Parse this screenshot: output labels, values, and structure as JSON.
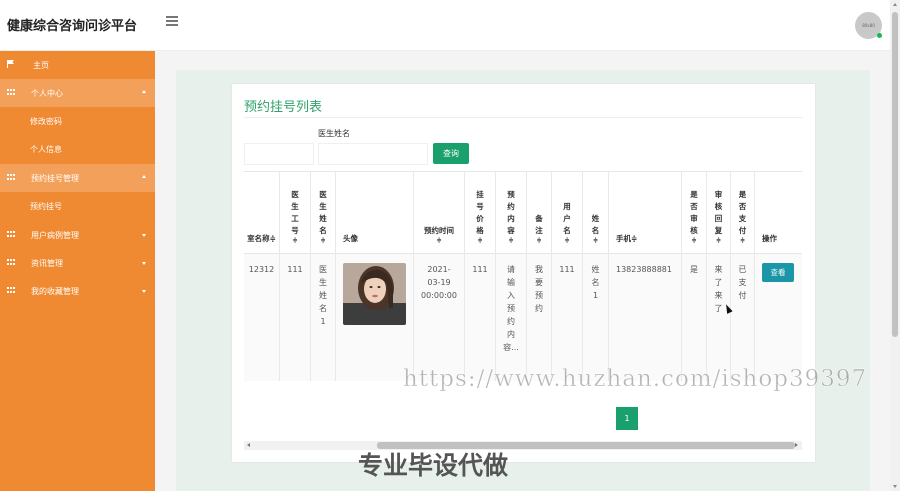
{
  "app": {
    "title": "健康综合咨询问诊平台",
    "avatar_text": "80x80"
  },
  "sidebar": {
    "items": [
      {
        "label": "主页",
        "icon": "flag-icon"
      },
      {
        "label": "个人中心",
        "icon": "grid-icon",
        "expanded": true
      },
      {
        "label": "修改密码",
        "sub": true
      },
      {
        "label": "个人信息",
        "sub": true
      },
      {
        "label": "预约挂号管理",
        "icon": "grid-icon",
        "expanded": true
      },
      {
        "label": "预约挂号",
        "sub": true
      },
      {
        "label": "用户病例管理",
        "icon": "grid-icon",
        "expanded": false
      },
      {
        "label": "资讯管理",
        "icon": "grid-icon",
        "expanded": false
      },
      {
        "label": "我的收藏管理",
        "icon": "grid-icon",
        "expanded": false
      }
    ]
  },
  "main": {
    "title": "预约挂号列表",
    "filter": {
      "doctor_label": "医生姓名",
      "doctor_value": "",
      "left_value": "",
      "search_button": "查询"
    },
    "table": {
      "headers": [
        "科室名称",
        "医生工号",
        "医生姓名",
        "头像",
        "预约时间",
        "挂号价格",
        "预约内容",
        "备注",
        "用户名",
        "姓名",
        "手机",
        "是否审核",
        "审核回复",
        "是否支付",
        "操作"
      ],
      "headers_display": [
        "室名称",
        "医\n生\n工\n号",
        "医\n生\n姓\n名",
        "头像",
        "预约时间",
        "挂\n号\n价\n格",
        "预\n约\n内\n容",
        "备\n注",
        "用\n户\n名",
        "姓\n名",
        "手机",
        "是\n否\n审\n核",
        "审\n核\n回\n复",
        "是\n否\n支\n付",
        "操作"
      ],
      "sortable": [
        true,
        true,
        true,
        false,
        true,
        true,
        true,
        true,
        true,
        true,
        true,
        true,
        true,
        true,
        false
      ],
      "rows": [
        {
          "dept": "12312",
          "doctor_id": "111",
          "doctor_name": "医\n生\n姓\n名\n1",
          "avatar": "avatar-photo",
          "time": "2021-\n03-19\n00:00:00",
          "price": "111",
          "content": "请\n输\n入\n预\n约\n内\n容...",
          "note": "我\n要\n预\n约",
          "username": "111",
          "name": "姓\n名\n1",
          "phone": "13823888881",
          "reviewed": "是",
          "reply": "来\n了\n来\n了",
          "paid": "已\n支\n付",
          "action": "查看"
        }
      ]
    },
    "pagination": {
      "current": "1"
    }
  },
  "watermarks": {
    "url": "https://www.huzhan.com/ishop39397",
    "text": "专业毕设代做"
  },
  "colors": {
    "sidebar": "#ef8a32",
    "accent": "#1aa06d",
    "title": "#2fa36b",
    "view_button": "#1a96a8"
  }
}
